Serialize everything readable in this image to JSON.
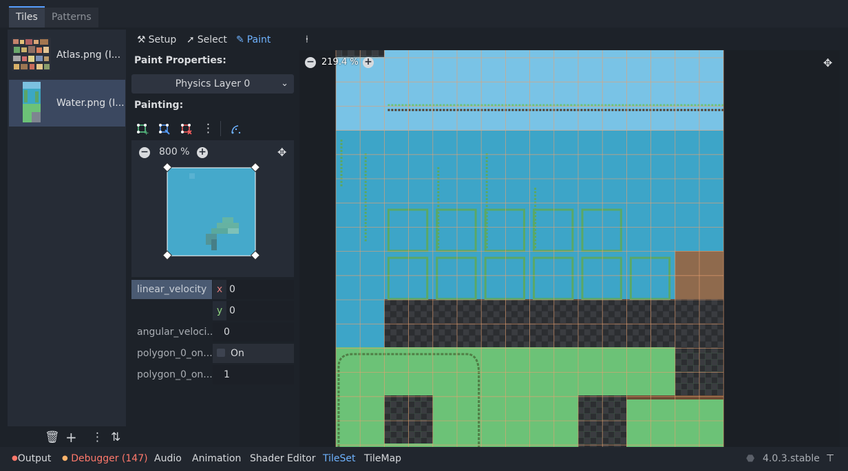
{
  "tabs": {
    "tiles": "Tiles",
    "patterns": "Patterns"
  },
  "sources": [
    {
      "label": "Atlas.png (I..."
    },
    {
      "label": "Water.png (I..."
    }
  ],
  "toolbar": {
    "setup": "Setup",
    "select": "Select",
    "paint": "Paint"
  },
  "paint_properties": {
    "heading": "Paint Properties:",
    "layer": "Physics Layer 0",
    "painting_heading": "Painting:"
  },
  "preview": {
    "zoom": "800 %"
  },
  "props": {
    "linear_velocity": {
      "label": "linear_velocity",
      "x_axis": "x",
      "x": "0",
      "y_axis": "y",
      "y": "0"
    },
    "angular_velocity": {
      "label": "angular_veloci...",
      "value": "0"
    },
    "polygon_one_way": {
      "label": "polygon_0_on...",
      "value": "On"
    },
    "polygon_margin": {
      "label": "polygon_0_on...",
      "value": "1"
    }
  },
  "atlas_view": {
    "zoom": "219.4 %"
  },
  "statusbar": {
    "output": "Output",
    "debugger": "Debugger (147)",
    "audio": "Audio",
    "animation": "Animation",
    "shader_editor": "Shader Editor",
    "tileset": "TileSet",
    "tilemap": "TileMap",
    "version": "4.0.3.stable"
  },
  "colors": {
    "accent": "#6fb3ff",
    "water": "#3da5c8",
    "grass": "#6cc277",
    "dirt": "#8f6a4d",
    "panel": "#262c36",
    "debugger": "#ff786b"
  }
}
